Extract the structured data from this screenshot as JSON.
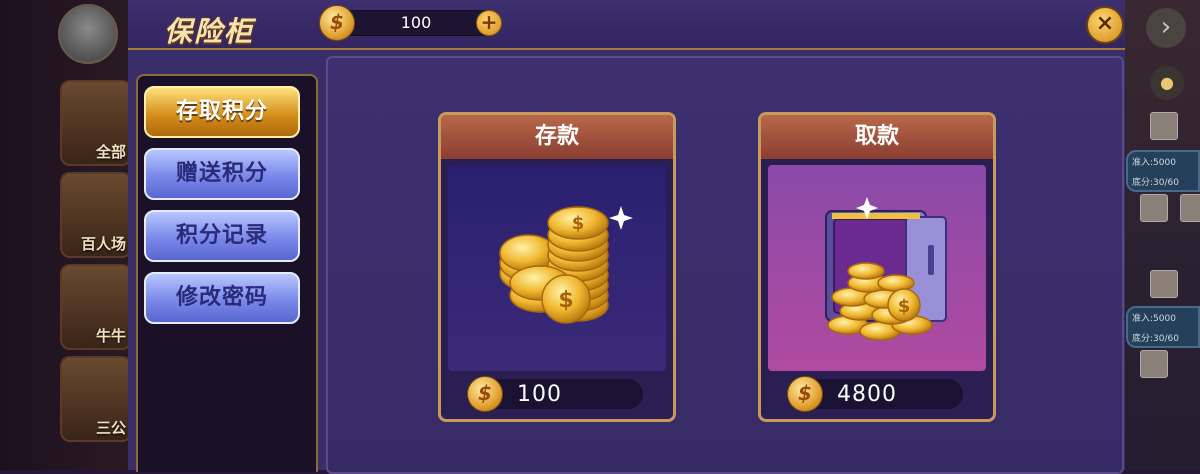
{
  "background": {
    "tile_labels": [
      "全部",
      "百人场",
      "牛牛",
      "三公"
    ],
    "table_entries": [
      "准入:5000",
      "底分:30/60",
      "准入:5000",
      "底分:30/60"
    ]
  },
  "dialog": {
    "title": "保险柜",
    "balance": "100",
    "plus_label": "+",
    "close_label": "×"
  },
  "sidebar": {
    "items": [
      {
        "label": "存取积分",
        "active": true
      },
      {
        "label": "赠送积分",
        "active": false
      },
      {
        "label": "积分记录",
        "active": false
      },
      {
        "label": "修改密码",
        "active": false
      }
    ]
  },
  "cards": {
    "deposit": {
      "title": "存款",
      "amount": "100"
    },
    "withdraw": {
      "title": "取款",
      "amount": "4800"
    }
  },
  "colors": {
    "dialog_bg": "#3a2e68",
    "gold": "#e0a030",
    "active_tab": "#d08a18",
    "inactive_tab": "#7a88ea",
    "card_border": "#c89a5a",
    "card_header": "#a0503c"
  },
  "icons": {
    "currency": "coin-icon",
    "close": "close-icon",
    "add": "plus-icon"
  }
}
